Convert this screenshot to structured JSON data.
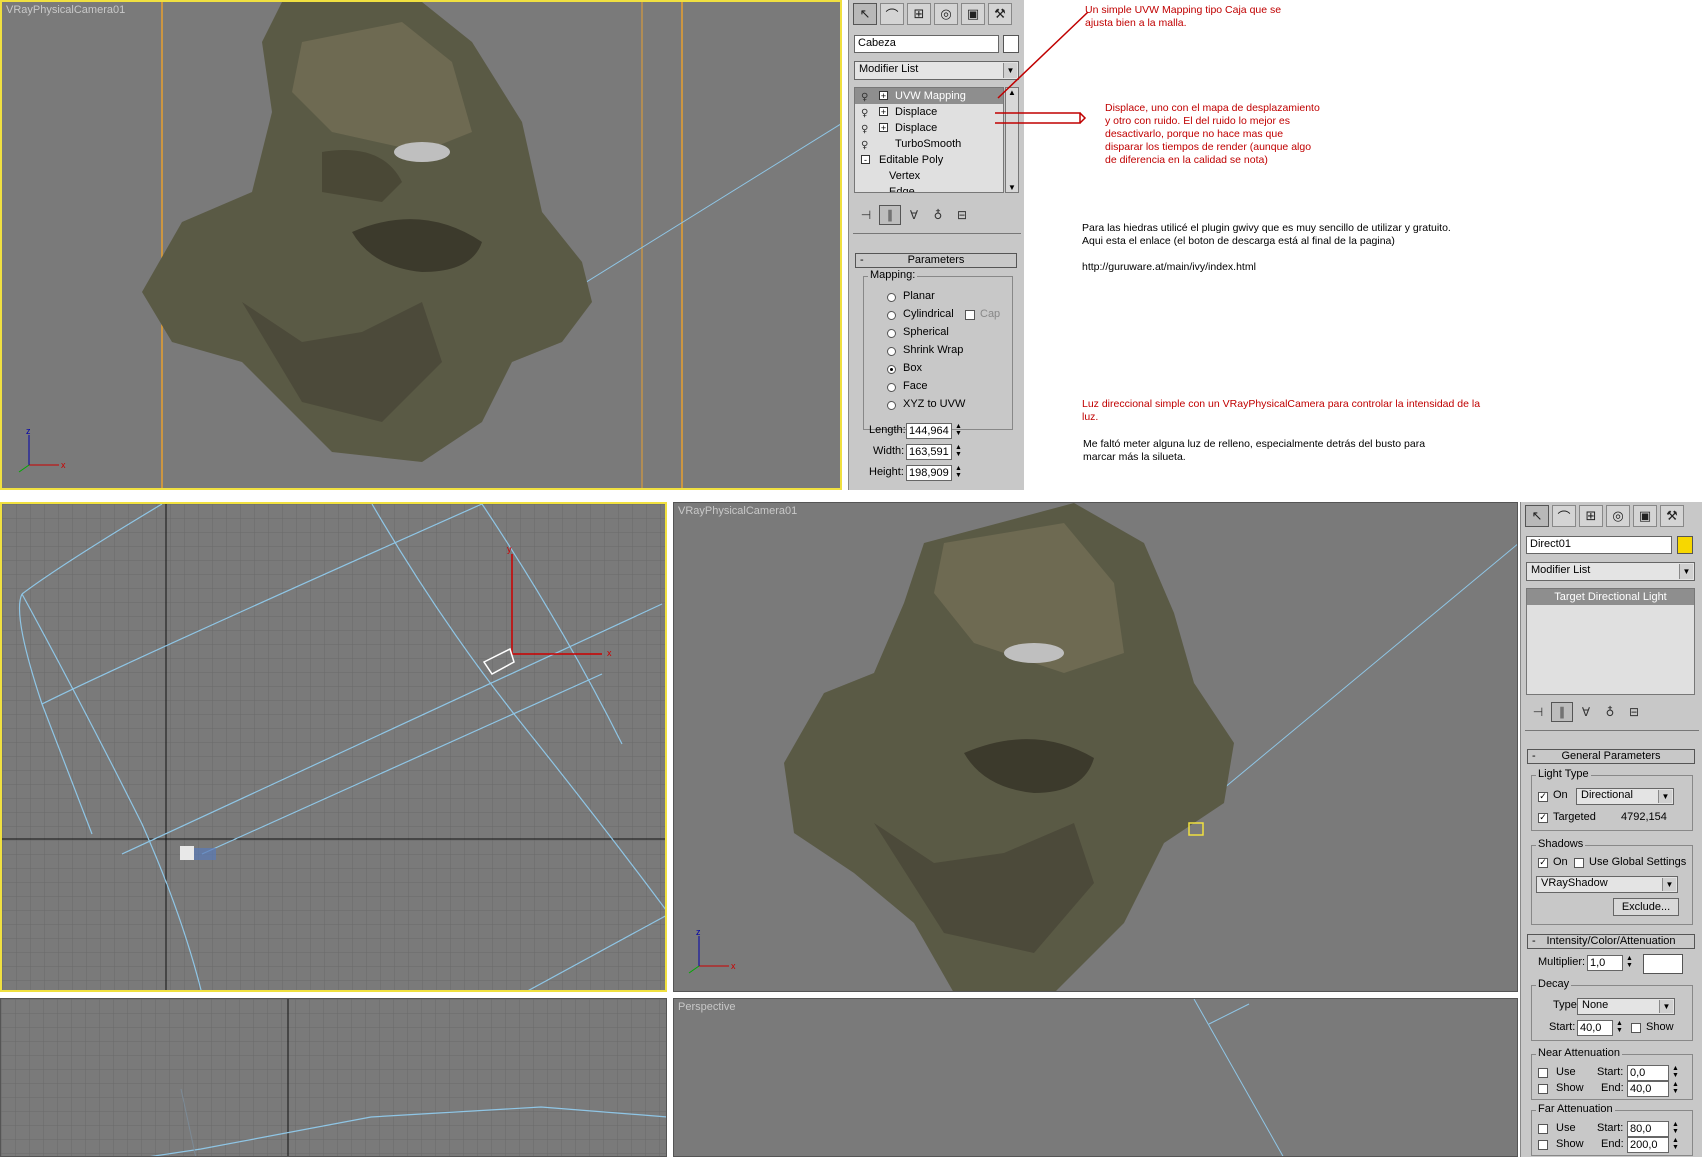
{
  "colors": {
    "viewport_bg": "#7a7a7a",
    "grid_line": "#666666",
    "grid_major": "#111111",
    "wire": "#8fc6e6",
    "active_border": "#f0e040",
    "annotation_red": "#c00000",
    "light_swatch": "#f7d700"
  },
  "top_viewport": {
    "label": "VRayPhysicalCamera01"
  },
  "top_panel": {
    "object_name": "Cabeza",
    "swatch_color": "#ffffff",
    "modifier_list": "Modifier List",
    "stack": [
      {
        "label": "UVW Mapping",
        "selected": true,
        "expander": "+"
      },
      {
        "label": "Displace",
        "selected": false,
        "expander": "+"
      },
      {
        "label": "Displace",
        "selected": false,
        "expander": "+"
      },
      {
        "label": "TurboSmooth",
        "selected": false,
        "expander": ""
      },
      {
        "label": "Editable Poly",
        "selected": false,
        "expander": "-"
      },
      {
        "label": "Vertex",
        "selected": false,
        "expander": ""
      },
      {
        "label": "Edge",
        "selected": false,
        "expander": ""
      }
    ],
    "parameters_title": "Parameters",
    "mapping_title": "Mapping:",
    "mapping_options": [
      "Planar",
      "Cylindrical",
      "Spherical",
      "Shrink Wrap",
      "Box",
      "Face",
      "XYZ to UVW"
    ],
    "mapping_selected": "Box",
    "cap_label": "Cap",
    "length_label": "Length:",
    "length_value": "144,964",
    "width_label": "Width:",
    "width_value": "163,591",
    "height_label": "Height:",
    "height_value": "198,909"
  },
  "annotations": {
    "note1": [
      "Un simple UVW Mapping tipo Caja que se",
      "ajusta bien a la malla."
    ],
    "note2": [
      "Displace, uno con el mapa de desplazamiento",
      "y otro con ruido. El del ruido lo mejor es",
      "desactivarlo, porque no hace mas que",
      "disparar los tiempos de render (aunque algo",
      "de diferencia en la calidad se nota)"
    ],
    "note3": [
      "Para las hiedras utilicé el plugin gwivy que es muy sencillo de utilizar y gratuito.",
      "Aqui esta el enlace (el boton de descarga está al final de la pagina)"
    ],
    "note3_url": "http://guruware.at/main/ivy/index.html",
    "note4": [
      "Luz direccional simple con un VRayPhysicalCamera para controlar la intensidad de la",
      "luz."
    ],
    "note5": [
      "Me faltó meter alguna luz de relleno, especialmente detrás del busto para",
      "marcar más la silueta."
    ]
  },
  "bottom_right_viewport": {
    "label": "VRayPhysicalCamera01"
  },
  "perspective_viewport": {
    "label": "Perspective"
  },
  "light_panel": {
    "object_name": "Direct01",
    "swatch_color": "#f7d700",
    "modifier_list": "Modifier List",
    "stack_item": "Target Directional Light",
    "general_title": "General Parameters",
    "light_type_title": "Light Type",
    "on_label": "On",
    "light_type": "Directional",
    "targeted_label": "Targeted",
    "targeted_value": "4792,154",
    "shadows_title": "Shadows",
    "shadow_on_label": "On",
    "global_label": "Use Global Settings",
    "shadow_type": "VRayShadow",
    "exclude_label": "Exclude...",
    "intensity_title": "Intensity/Color/Attenuation",
    "multiplier_label": "Multiplier:",
    "multiplier_value": "1,0",
    "decay_title": "Decay",
    "decay_type_label": "Type:",
    "decay_type": "None",
    "decay_start_label": "Start:",
    "decay_start": "40,0",
    "decay_show_label": "Show",
    "near_title": "Near Attenuation",
    "near_use_label": "Use",
    "near_show_label": "Show",
    "near_start_label": "Start:",
    "near_start": "0,0",
    "near_end_label": "End:",
    "near_end": "40,0",
    "far_title": "Far Attenuation",
    "far_use_label": "Use",
    "far_show_label": "Show",
    "far_start_label": "Start:",
    "far_start": "80,0",
    "far_end_label": "End:",
    "far_end": "200,0"
  },
  "axis": {
    "x": "x",
    "y": "y",
    "z": "z"
  }
}
